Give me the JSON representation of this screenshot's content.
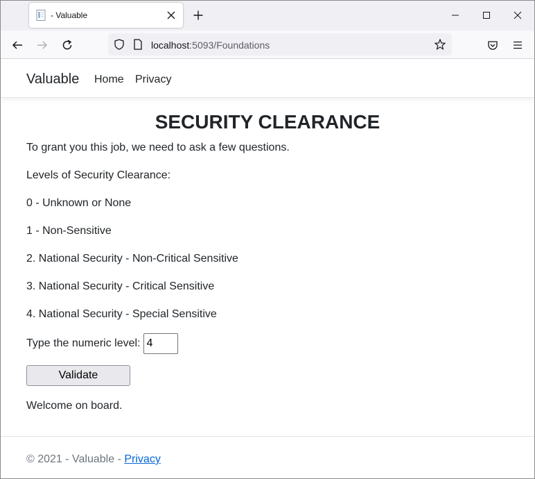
{
  "browser": {
    "tab_title": "- Valuable",
    "url_host": "localhost",
    "url_rest": ":5093/Foundations",
    "icons": {
      "tab_close": "close-icon",
      "new_tab": "plus-icon",
      "back": "back-arrow-icon",
      "forward": "forward-arrow-icon",
      "reload": "reload-icon",
      "site_info": "shield-icon",
      "page": "page-icon",
      "bookmark": "star-icon",
      "pocket": "pocket-icon",
      "menu": "hamburger-icon"
    }
  },
  "nav": {
    "brand": "Valuable",
    "links": [
      "Home",
      "Privacy"
    ]
  },
  "main": {
    "title": "SECURITY CLEARANCE",
    "intro": "To grant you this job, we need to ask a few questions.",
    "levels_heading": "Levels of Security Clearance:",
    "levels": [
      "0 - Unknown or None",
      "1 - Non-Sensitive",
      "2. National Security - Non-Critical Sensitive",
      "3. National Security - Critical Sensitive",
      "4. National Security - Special Sensitive"
    ],
    "input_label": "Type the numeric level:",
    "input_value": "4",
    "button_label": "Validate",
    "result": "Welcome on board."
  },
  "footer": {
    "text": "© 2021 - Valuable - ",
    "link": "Privacy"
  },
  "colors": {
    "link": "#0366d6",
    "footer_text": "#6c757d",
    "body_text": "#212529"
  }
}
